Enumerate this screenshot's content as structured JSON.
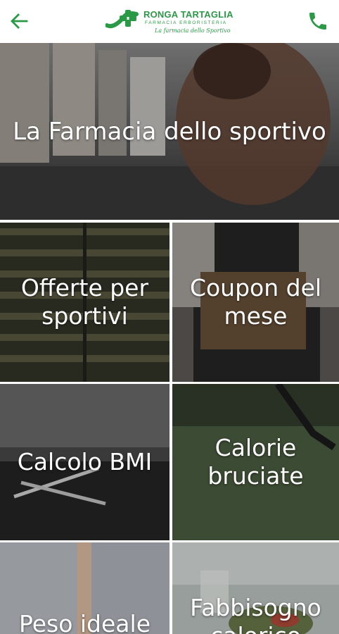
{
  "appbar": {
    "back_icon": "arrow-left-icon",
    "call_icon": "phone-icon",
    "accent_color": "#2b9a47",
    "logo": {
      "name": "RONGA TARTAGLIA",
      "subtitle": "FARMACIA ERBORISTERIA",
      "tagline": "La farmacia dello Sportivo"
    }
  },
  "hero": {
    "title": "La Farmacia dello sportivo"
  },
  "tiles": [
    {
      "label": "Offerte per sportivi"
    },
    {
      "label": "Coupon del mese"
    },
    {
      "label": "Calcolo BMI"
    },
    {
      "label": "Calorie bruciate"
    },
    {
      "label": "Peso ideale"
    },
    {
      "label": "Fabbisogno calorico"
    }
  ]
}
